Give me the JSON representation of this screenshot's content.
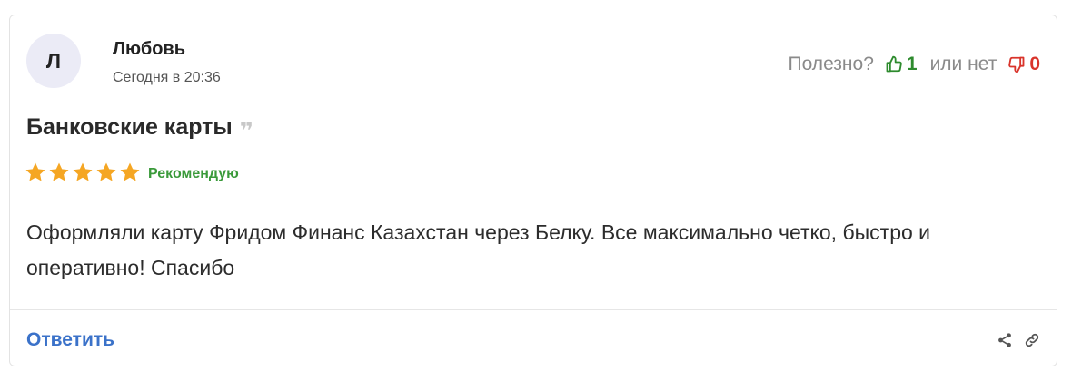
{
  "review": {
    "avatar_letter": "Л",
    "author": "Любовь",
    "date": "Сегодня в 20:36",
    "useful_label": "Полезно?",
    "likes": "1",
    "or_label": "или нет",
    "dislikes": "0",
    "title": "Банковские карты",
    "rating": 5,
    "recommend_label": "Рекомендую",
    "text": "Оформляли карту Фридом Финанс Казахстан через Белку. Все максимально четко, быстро и оперативно! Спасибо",
    "reply_label": "Ответить"
  },
  "icons": {
    "like": "thumb-up-icon",
    "dislike": "thumb-down-icon",
    "quote": "quote-icon",
    "star": "star-icon",
    "share": "share-icon",
    "link": "link-icon"
  },
  "colors": {
    "like": "#2e8b2e",
    "dislike": "#d9342b",
    "star": "#f5a623",
    "recommend": "#3a9a3a",
    "reply": "#3b72c9"
  }
}
